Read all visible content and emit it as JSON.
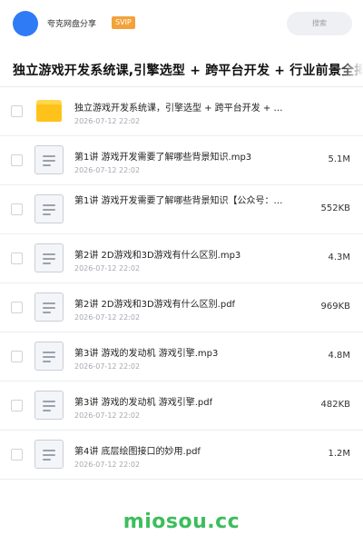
{
  "header": {
    "owner_name": "夸克网盘分享",
    "badge": "SVIP",
    "search_placeholder": "搜索",
    "avatar_color": "#2f7bf5",
    "badge_color": "#f3a23a"
  },
  "page_title": "独立游戏开发系统课,引擎选型 + 跨平台开发 + 行业前景全揭秘",
  "files": [
    {
      "type": "folder-icon",
      "name": "独立游戏开发系统课，引擎选型 + 跨平台开发 + …",
      "date": "2026-07-12 22:02",
      "size": ""
    },
    {
      "type": "document-icon",
      "name": "第1讲   游戏开发需要了解哪些背景知识.mp3",
      "date": "2026-07-12 22:02",
      "size": "5.1M"
    },
    {
      "type": "document-icon",
      "name": "第1讲 游戏开发需要了解哪些背景知识【公众号：…",
      "date": "",
      "size": "552KB"
    },
    {
      "type": "document-icon",
      "name": "第2讲   2D游戏和3D游戏有什么区别.mp3",
      "date": "2026-07-12 22:02",
      "size": "4.3M"
    },
    {
      "type": "document-icon",
      "name": "第2讲   2D游戏和3D游戏有什么区别.pdf",
      "date": "2026-07-12 22:02",
      "size": "969KB"
    },
    {
      "type": "document-icon",
      "name": "第3讲   游戏的发动机 游戏引擎.mp3",
      "date": "2026-07-12 22:02",
      "size": "4.8M"
    },
    {
      "type": "document-icon",
      "name": "第3讲   游戏的发动机 游戏引擎.pdf",
      "date": "2026-07-12 22:02",
      "size": "482KB"
    },
    {
      "type": "document-icon",
      "name": "第4讲   底层绘图接口的妙用.pdf",
      "date": "2026-07-12 22:02",
      "size": "1.2M"
    }
  ],
  "watermark": "miosou.cc",
  "watermark_color": "#3dbd5c"
}
